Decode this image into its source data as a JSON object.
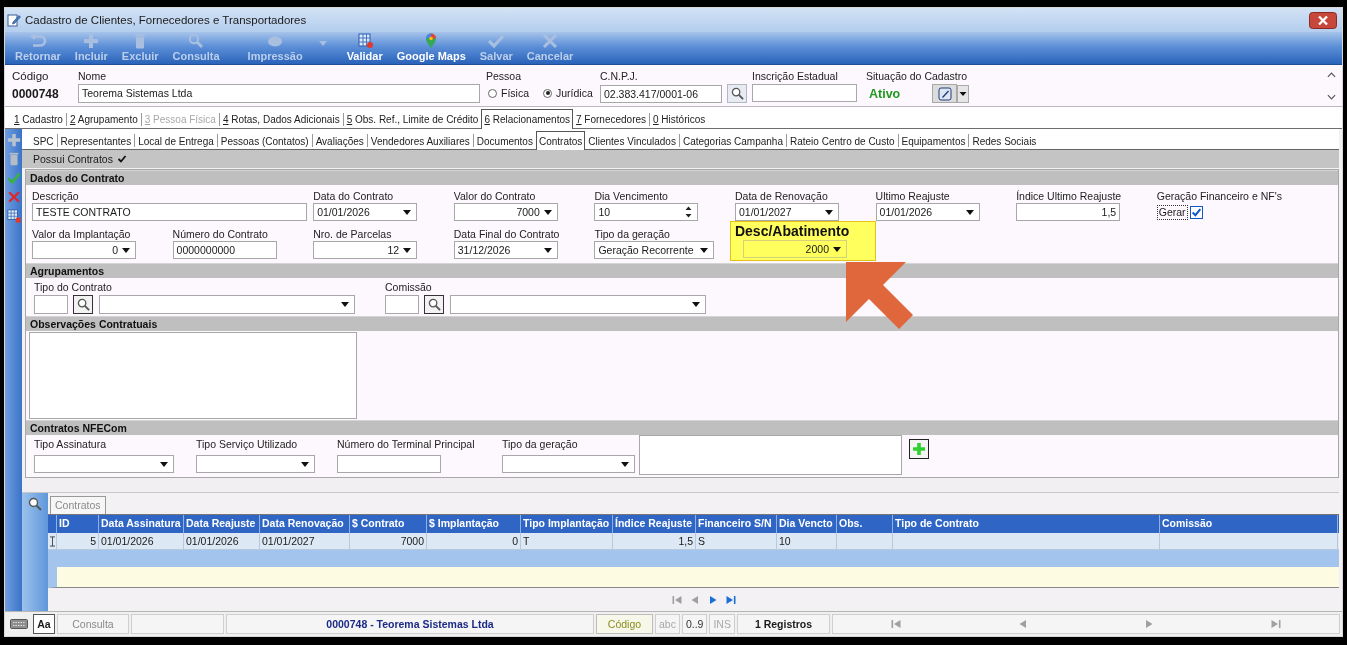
{
  "window": {
    "title": "Cadastro de Clientes, Fornecedores e Transportadores"
  },
  "toolbar": [
    {
      "kind": "return",
      "label": "Retornar",
      "disabled": true
    },
    {
      "kind": "add",
      "label": "Incluir",
      "disabled": true
    },
    {
      "kind": "delete",
      "label": "Excluir",
      "disabled": true
    },
    {
      "kind": "search",
      "label": "Consulta",
      "disabled": true
    },
    {
      "kind": "print",
      "label": "Impressão",
      "disabled": true
    },
    {
      "kind": "menu",
      "disabled": true
    },
    {
      "kind": "validate",
      "label": "Validar",
      "disabled": false
    },
    {
      "kind": "map",
      "label": "Google Maps",
      "disabled": false
    },
    {
      "kind": "save",
      "label": "Salvar",
      "disabled": true
    },
    {
      "kind": "cancel",
      "label": "Cancelar",
      "disabled": true
    }
  ],
  "header": {
    "code_label": "Código",
    "code": "0000748",
    "name_label": "Nome",
    "name": "Teorema Sistemas Ltda",
    "person_label": "Pessoa",
    "person_types": [
      {
        "label": "Física",
        "selected": false
      },
      {
        "label": "Jurídica",
        "selected": true
      }
    ],
    "cnpj_label": "C.N.P.J.",
    "cnpj": "02.383.417/0001-06",
    "state_registration_label": "Inscrição Estadual",
    "status_label": "Situação do Cadastro",
    "status": "Ativo"
  },
  "tabs": [
    {
      "key": "1",
      "label": "Cadastro",
      "selected": false,
      "disabled": false
    },
    {
      "key": "2",
      "label": "Agrupamento",
      "selected": false,
      "disabled": false
    },
    {
      "key": "3",
      "label": "Pessoa Física",
      "selected": false,
      "disabled": true
    },
    {
      "key": "4",
      "label": "Rotas, Dados Adicionais",
      "selected": false,
      "disabled": false
    },
    {
      "key": "5",
      "label": "Obs. Ref., Limite de Crédito",
      "selected": false,
      "disabled": false
    },
    {
      "key": "6",
      "label": "Relacionamentos",
      "selected": true,
      "disabled": false
    },
    {
      "key": "7",
      "label": "Fornecedores",
      "selected": false,
      "disabled": false
    },
    {
      "key": "0",
      "label": "Históricos",
      "selected": false,
      "disabled": false
    }
  ],
  "subtabs": [
    {
      "label": "SPC",
      "selected": false
    },
    {
      "label": "Representantes",
      "selected": false
    },
    {
      "label": "Local de Entrega",
      "selected": false
    },
    {
      "label": "Pessoas (Contatos)",
      "selected": false
    },
    {
      "label": "Avaliações",
      "selected": false
    },
    {
      "label": "Vendedores Auxiliares",
      "selected": false
    },
    {
      "label": "Documentos",
      "selected": false
    },
    {
      "label": "Contratos",
      "selected": true
    },
    {
      "label": "Clientes Vinculados",
      "selected": false
    },
    {
      "label": "Categorias Campanha",
      "selected": false
    },
    {
      "label": "Rateio Centro de Custo",
      "selected": false
    },
    {
      "label": "Equipamentos",
      "selected": false
    },
    {
      "label": "Redes Sociais",
      "selected": false
    }
  ],
  "side_actions": [
    {
      "kind": "add",
      "disabled": true
    },
    {
      "kind": "delete",
      "disabled": true
    },
    {
      "kind": "confirm",
      "disabled": false
    },
    {
      "kind": "cancel",
      "disabled": false
    },
    {
      "kind": "grid",
      "disabled": false
    }
  ],
  "has_contracts": {
    "label": "Possui Contratos",
    "checked": true
  },
  "contract_data": {
    "title": "Dados do Contrato",
    "fields": [
      {
        "kind": "text",
        "label": "Descrição",
        "value": "TESTE CONTRATO",
        "highlighted": false
      },
      {
        "kind": "date",
        "label": "Data do Contrato",
        "value": "01/01/2026",
        "highlighted": false
      },
      {
        "kind": "amount",
        "label": "Valor do Contrato",
        "value": "7000",
        "highlighted": false
      },
      {
        "kind": "spin",
        "label": "Dia Vencimento",
        "value": "10",
        "highlighted": false
      },
      {
        "kind": "date",
        "label": "Data de Renovação",
        "value": "01/01/2027",
        "highlighted": false
      },
      {
        "kind": "date",
        "label": "Ultimo Reajuste",
        "value": "01/01/2026",
        "highlighted": false
      },
      {
        "kind": "number",
        "label": "Índice Ultimo Reajuste",
        "value": "1,5",
        "highlighted": false
      },
      {
        "kind": "check",
        "label": "Geração Financeiro e NF's",
        "value": "Gerar",
        "checked": true,
        "highlighted": false
      },
      {
        "kind": "amount",
        "label": "Valor da Implantação",
        "value": "0",
        "highlighted": false
      },
      {
        "kind": "text",
        "label": "Número do Contrato",
        "value": "0000000000",
        "highlighted": false
      },
      {
        "kind": "amount",
        "label": "Nro. de Parcelas",
        "value": "12",
        "highlighted": false
      },
      {
        "kind": "date",
        "label": "Data Final do Contrato",
        "value": "31/12/2026",
        "highlighted": false
      },
      {
        "kind": "select",
        "label": "Tipo da geração",
        "value": "Geração Recorrente",
        "highlighted": false
      },
      {
        "kind": "amount",
        "label": "Desc/Abatimento",
        "value": "2000",
        "highlighted": true
      }
    ]
  },
  "groupings": {
    "title": "Agrupamentos",
    "fields": [
      {
        "label": "Tipo do Contrato"
      },
      {
        "label": "Comissão"
      }
    ]
  },
  "notes": {
    "title": "Observações Contratuais"
  },
  "nfecom": {
    "title": "Contratos NFECom",
    "fields": [
      {
        "kind": "select",
        "label": "Tipo Assinatura"
      },
      {
        "kind": "select",
        "label": "Tipo Serviço Utilizado"
      },
      {
        "kind": "text",
        "label": "Número do Terminal Principal"
      },
      {
        "kind": "select",
        "label": "Tipo da geração"
      },
      {
        "kind": "memo"
      },
      {
        "kind": "add"
      }
    ]
  },
  "grid": {
    "tab": "Contratos",
    "columns": [
      "ID",
      "Data Assinatura",
      "Data Reajuste",
      "Data Renovação",
      "$ Contrato",
      "$ Implantação",
      "Tipo Implantação",
      "Índice Reajuste",
      "Financeiro S/N",
      "Dia Vencto",
      "Obs.",
      "Tipo de Contrato",
      "Comissão"
    ],
    "rows": [
      {
        "current": true,
        "cells": [
          "5",
          "01/01/2026",
          "01/01/2026",
          "01/01/2027",
          "7000",
          "0",
          "T",
          "1,5",
          "S",
          "10"
        ]
      }
    ],
    "nav": [
      {
        "kind": "first",
        "disabled": true
      },
      {
        "kind": "prev",
        "disabled": true
      },
      {
        "kind": "next",
        "disabled": false
      },
      {
        "kind": "last",
        "disabled": false
      }
    ]
  },
  "status_bar": [
    {
      "kind": "keyboard"
    },
    {
      "kind": "font",
      "text": "Aa"
    },
    {
      "kind": "mode",
      "text": "Consulta"
    },
    {
      "kind": "blank"
    },
    {
      "kind": "record",
      "text": "0000748 - Teorema Sistemas Ltda"
    },
    {
      "kind": "key",
      "text": "Código"
    },
    {
      "kind": "flag",
      "text": "abc",
      "disabled": true
    },
    {
      "kind": "flag",
      "text": "0..9",
      "disabled": false
    },
    {
      "kind": "flag",
      "text": "INS",
      "disabled": true
    },
    {
      "kind": "count",
      "text": "1 Registros"
    },
    {
      "kind": "nav",
      "buttons": [
        {
          "kind": "first",
          "disabled": true
        },
        {
          "kind": "prev",
          "disabled": true
        },
        {
          "kind": "next",
          "disabled": true
        },
        {
          "kind": "last",
          "disabled": true
        }
      ]
    }
  ]
}
